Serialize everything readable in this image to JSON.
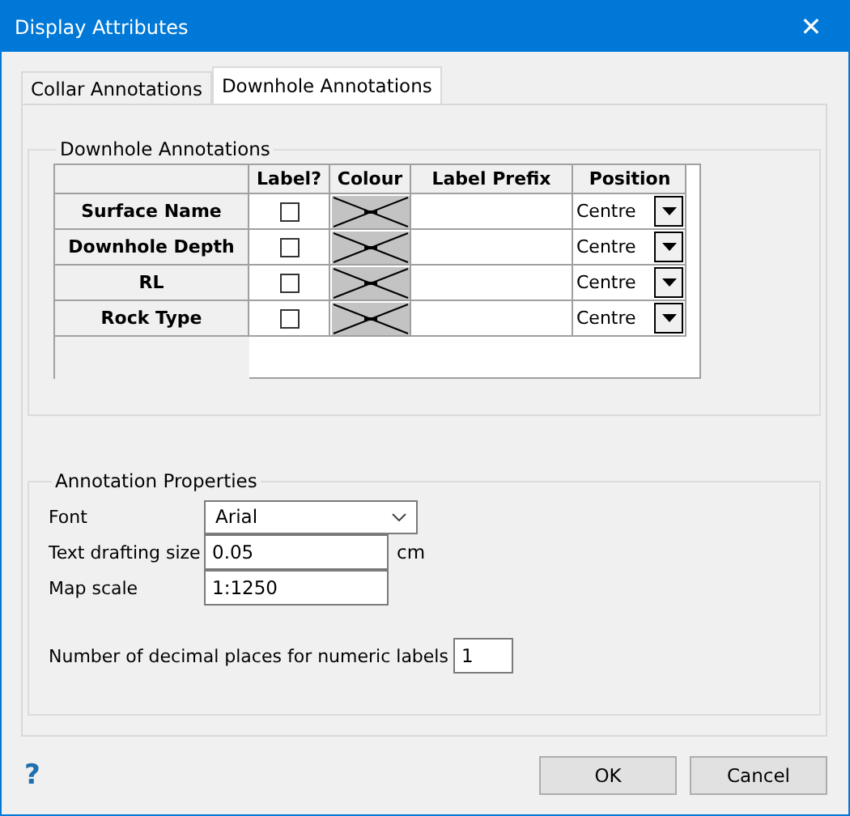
{
  "window": {
    "title": "Display Attributes",
    "close": "✕"
  },
  "tabs": [
    {
      "label": "Collar Annotations",
      "selected": false
    },
    {
      "label": "Downhole Annotations",
      "selected": true
    }
  ],
  "downhole_group": {
    "title": "Downhole Annotations",
    "columns": [
      "Label?",
      "Colour",
      "Label Prefix",
      "Position"
    ],
    "rows": [
      {
        "name": "Surface Name",
        "label_checked": false,
        "position": "Centre"
      },
      {
        "name": "Downhole Depth",
        "label_checked": false,
        "position": "Centre"
      },
      {
        "name": "RL",
        "label_checked": false,
        "position": "Centre"
      },
      {
        "name": "Rock Type",
        "label_checked": false,
        "position": "Centre"
      }
    ]
  },
  "properties_group": {
    "title": "Annotation Properties",
    "font_label": "Font",
    "font_value": "Arial",
    "size_label": "Text drafting size",
    "size_value": "0.05",
    "size_unit": "cm",
    "scale_label": "Map scale",
    "scale_value": "1:1250",
    "decimals_label": "Number of decimal places for numeric labels",
    "decimals_value": "1"
  },
  "help": "?",
  "buttons": [
    "OK",
    "Cancel"
  ]
}
